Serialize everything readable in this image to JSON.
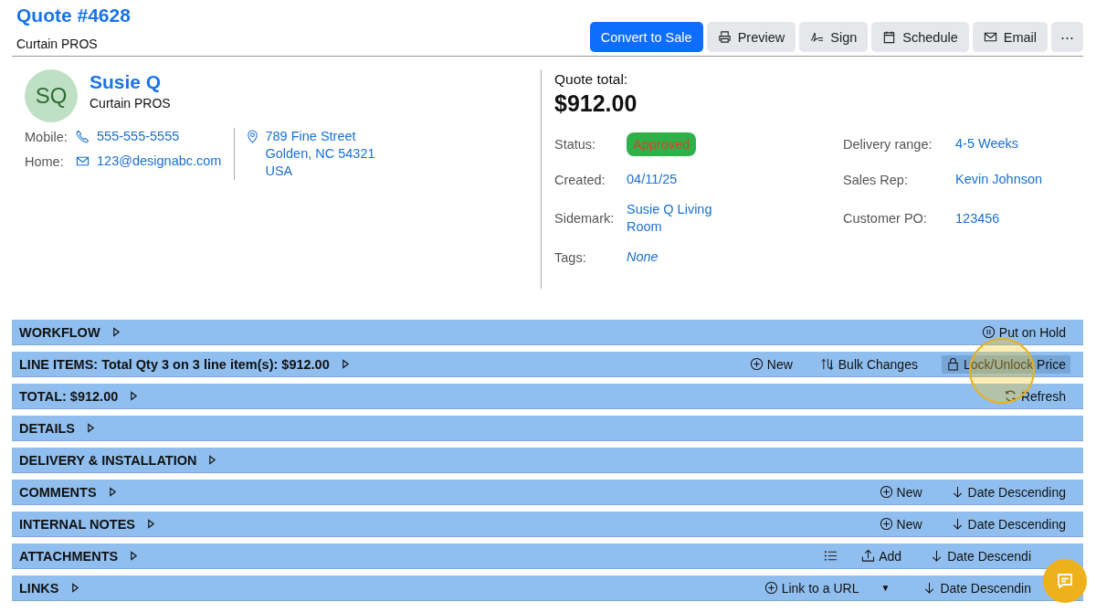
{
  "header": {
    "title": "Quote #4628",
    "subtitle": "Curtain PROS"
  },
  "actions": [
    {
      "label": "Convert to Sale",
      "kind": "primary"
    },
    {
      "label": "Preview",
      "kind": "print"
    },
    {
      "label": "Sign",
      "kind": "sign"
    },
    {
      "label": "Schedule",
      "kind": "calendar"
    },
    {
      "label": "Email",
      "kind": "mail"
    },
    {
      "label": "⋯",
      "kind": "more"
    }
  ],
  "contact": {
    "initials": "SQ",
    "name": "Susie Q",
    "company": "Curtain PROS",
    "lines": [
      {
        "label": "Mobile:",
        "kind": "phone",
        "value": "555-555-5555"
      },
      {
        "label": "Home:",
        "kind": "mail",
        "value": "123@designabc.com"
      }
    ],
    "address": [
      "789 Fine Street",
      "Golden, NC 54321",
      "USA"
    ]
  },
  "summary": {
    "label": "Quote total:",
    "amount": "$912.00",
    "fields": [
      {
        "label": "Status:",
        "value": "Approved",
        "kind": "badge"
      },
      {
        "label": "Delivery range:",
        "value": "4-5 Weeks",
        "kind": "link"
      },
      {
        "label": "Created:",
        "value": "04/11/25",
        "kind": "link"
      },
      {
        "label": "Sales Rep:",
        "value": "Kevin Johnson",
        "kind": "link"
      },
      {
        "label": "Sidemark:",
        "value": "Susie Q Living Room",
        "kind": "link"
      },
      {
        "label": "Customer PO:",
        "value": "123456",
        "kind": "link"
      },
      {
        "label": "Tags:",
        "value": "None",
        "kind": "empty"
      }
    ]
  },
  "sections": [
    {
      "title": "WORKFLOW",
      "actions": [
        {
          "kind": "pause",
          "label": "Put on Hold",
          "highlighted": false
        }
      ]
    },
    {
      "title": "LINE ITEMS: Total Qty 3 on 3 line item(s): $912.00",
      "actions": [
        {
          "kind": "plus",
          "label": "New",
          "highlighted": false
        },
        {
          "kind": "bulk",
          "label": "Bulk Changes",
          "highlighted": false
        },
        {
          "kind": "lock",
          "label": "Lock/Unlock Price",
          "highlighted": true
        }
      ]
    },
    {
      "title": "TOTAL: $912.00",
      "actions": [
        {
          "kind": "refresh",
          "label": "Refresh",
          "highlighted": false
        }
      ]
    },
    {
      "title": "DETAILS"
    },
    {
      "title": "DELIVERY & INSTALLATION"
    },
    {
      "title": "COMMENTS",
      "actions": [
        {
          "kind": "plus",
          "label": "New",
          "highlighted": false
        },
        {
          "kind": "down",
          "label": "Date Descending",
          "highlighted": false
        }
      ]
    },
    {
      "title": "INTERNAL NOTES",
      "actions": [
        {
          "kind": "plus",
          "label": "New",
          "highlighted": false
        },
        {
          "kind": "down",
          "label": "Date Descending",
          "highlighted": false
        }
      ]
    },
    {
      "title": "ATTACHMENTS",
      "actions": [
        {
          "kind": "list",
          "highlighted": false
        },
        {
          "kind": "upload",
          "label": "Add",
          "highlighted": false
        },
        {
          "kind": "down",
          "label": "Date Descendi",
          "highlighted": false
        }
      ]
    },
    {
      "title": "LINKS",
      "actions": [
        {
          "kind": "plus",
          "label": "Link to a URL",
          "highlighted": false
        },
        {
          "kind": "dropdown",
          "label": "▼",
          "highlighted": false
        },
        {
          "kind": "down",
          "label": "Date Descendin",
          "highlighted": false
        }
      ]
    }
  ]
}
